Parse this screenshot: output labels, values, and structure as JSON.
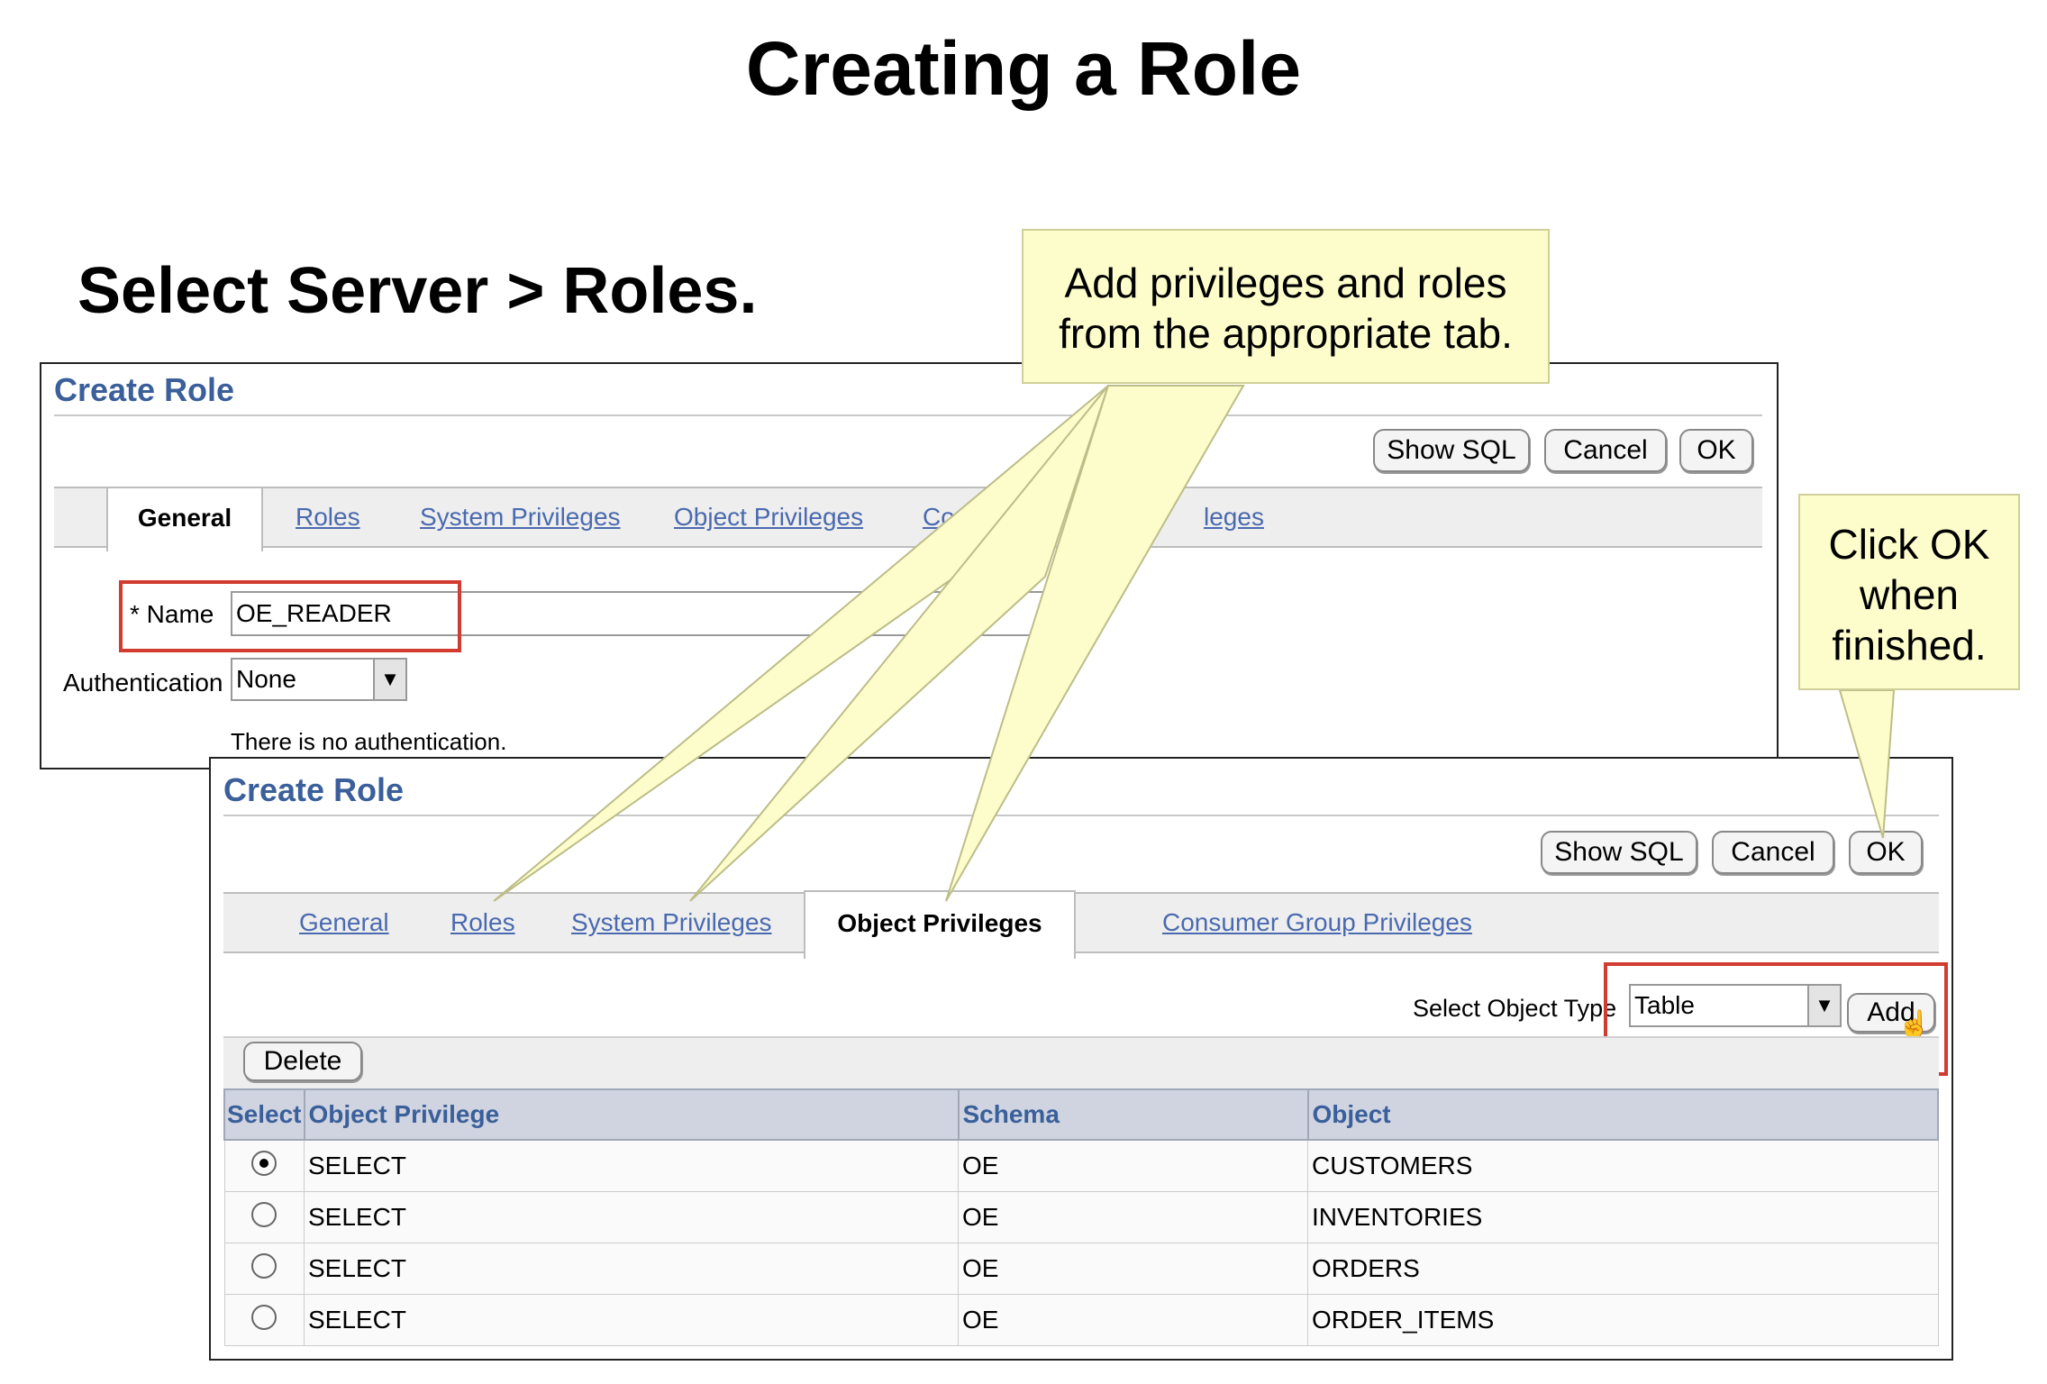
{
  "title": "Creating a Role",
  "subtitle": "Select Server > Roles.",
  "callouts": {
    "add_privileges": "Add privileges and roles from the appropriate tab.",
    "click_ok": "Click OK when finished."
  },
  "panel1": {
    "title": "Create Role",
    "buttons": {
      "show_sql": "Show SQL",
      "cancel": "Cancel",
      "ok": "OK"
    },
    "tabs": {
      "active": "General",
      "roles": "Roles",
      "system_privileges": "System Privileges",
      "object_privileges": "Object Privileges",
      "consumer_partial": "Co",
      "privileges_partial": "leges"
    },
    "name_label": "* Name",
    "name_value": "OE_READER",
    "auth_label": "Authentication",
    "auth_value": "None",
    "auth_note": "There is no authentication."
  },
  "panel2": {
    "title": "Create Role",
    "buttons": {
      "show_sql": "Show SQL",
      "cancel": "Cancel",
      "ok": "OK",
      "add": "Add",
      "delete": "Delete"
    },
    "tabs": {
      "general": "General",
      "roles": "Roles",
      "system_privileges": "System Privileges",
      "active": "Object Privileges",
      "consumer_group": "Consumer Group Privileges"
    },
    "object_type_label": "Select Object Type",
    "object_type_value": "Table",
    "table": {
      "headers": [
        "Select",
        "Object Privilege",
        "Schema",
        "Object"
      ],
      "rows": [
        {
          "selected": true,
          "privilege": "SELECT",
          "schema": "OE",
          "object": "CUSTOMERS"
        },
        {
          "selected": false,
          "privilege": "SELECT",
          "schema": "OE",
          "object": "INVENTORIES"
        },
        {
          "selected": false,
          "privilege": "SELECT",
          "schema": "OE",
          "object": "ORDERS"
        },
        {
          "selected": false,
          "privilege": "SELECT",
          "schema": "OE",
          "object": "ORDER_ITEMS"
        }
      ]
    }
  }
}
